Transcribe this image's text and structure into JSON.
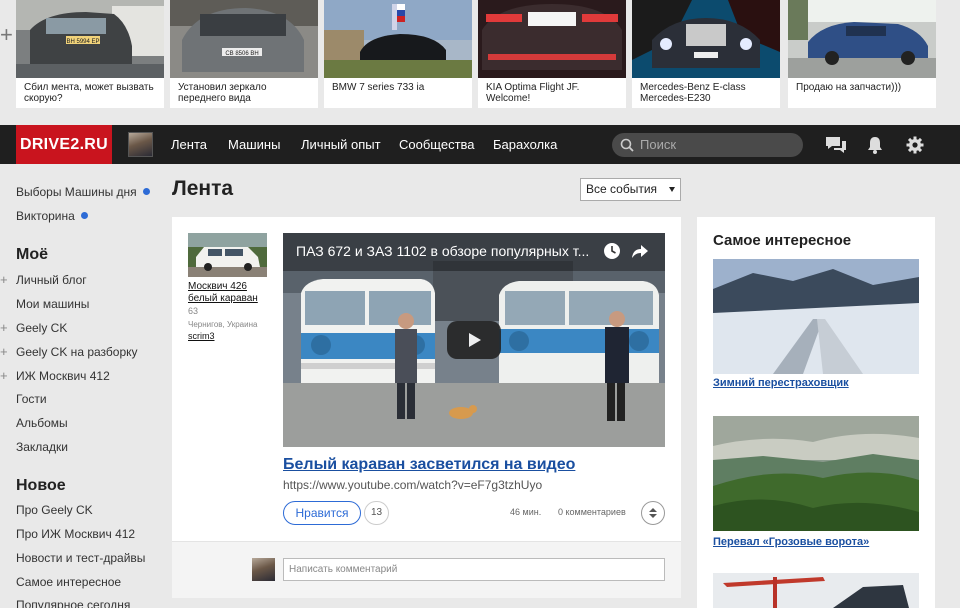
{
  "promo": {
    "cards": [
      {
        "caption": "Сбил мента, может вызвать скорую?",
        "plate": "ВН 5994 ЕР"
      },
      {
        "caption": "Установил зеркало переднего вида",
        "plate": "СВ 8506 ВН"
      },
      {
        "caption": "BMW 7 series 733 ia",
        "plate": ""
      },
      {
        "caption": "KIA Optima Flight JF. Welcome!",
        "plate": ""
      },
      {
        "caption": "Mercedes-Benz E-class Mercedes-E230",
        "plate": ""
      },
      {
        "caption": "Продаю на запчасти)))",
        "plate": ""
      }
    ]
  },
  "header": {
    "logo": "DRIVE2.RU",
    "nav": [
      "Лента",
      "Машины",
      "Личный опыт",
      "Сообщества",
      "Барахолка"
    ],
    "search_placeholder": "Поиск"
  },
  "sidebar": {
    "top_links": [
      "Выборы Машины дня",
      "Викторина"
    ],
    "my_heading": "Моё",
    "my_links": [
      "Личный блог",
      "Мои машины",
      "Geely CK",
      "Geely CK на разборку",
      "ИЖ Москвич 412",
      "Гости",
      "Альбомы",
      "Закладки"
    ],
    "new_heading": "Новое",
    "new_links": [
      "Про Geely CK",
      "Про ИЖ Москвич 412",
      "Новости и тест-драйвы",
      "Самое интересное",
      "Популярное сегодня"
    ]
  },
  "feed": {
    "title": "Лента",
    "filter": "Все события"
  },
  "post": {
    "car_name": "Москвич 426 белый караван",
    "car_count": "63",
    "location": "Чернигов, Украина",
    "user": "scrim3",
    "video_title": "ПАЗ 672 и ЗАЗ 1102 в обзоре популярных т...",
    "title": "Белый караван засветился на видео",
    "url": "https://www.youtube.com/watch?v=eF7g3tzhUyo",
    "like_label": "Нравится",
    "like_count": "13",
    "time": "46 мин.",
    "comments": "0 комментариев",
    "comment_placeholder": "Написать комментарий"
  },
  "right": {
    "heading": "Самое интересное",
    "items": [
      {
        "caption": "Зимний перестраховщик"
      },
      {
        "caption": "Перевал «Грозовые ворота»"
      }
    ]
  }
}
